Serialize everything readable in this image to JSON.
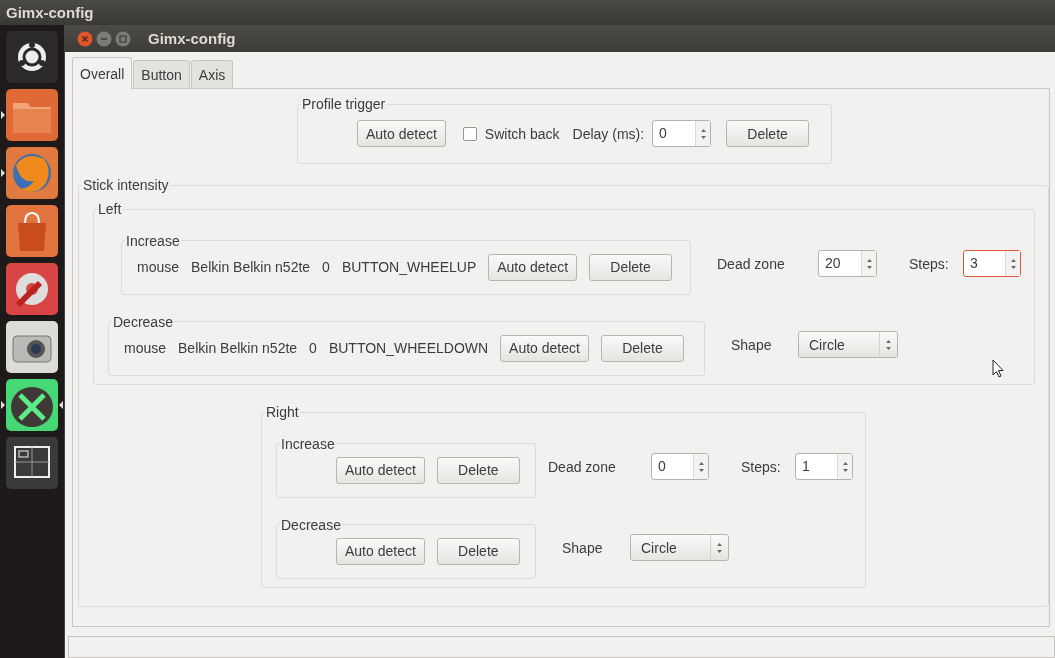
{
  "top_bar": {
    "title": "Gimx-config"
  },
  "launcher": {
    "items": [
      {
        "kind": "dash",
        "running": false,
        "selected": false
      },
      {
        "kind": "files",
        "running": true,
        "selected": false
      },
      {
        "kind": "browser",
        "running": true,
        "selected": false
      },
      {
        "kind": "store",
        "running": false,
        "selected": false
      },
      {
        "kind": "settings",
        "running": false,
        "selected": false
      },
      {
        "kind": "camera",
        "running": false,
        "selected": false
      },
      {
        "kind": "tools",
        "running": true,
        "selected": true
      },
      {
        "kind": "workspaces",
        "running": false,
        "selected": false
      }
    ]
  },
  "window": {
    "title": "Gimx-config"
  },
  "tabs": [
    {
      "label": "Overall",
      "selected": true
    },
    {
      "label": "Button",
      "selected": false
    },
    {
      "label": "Axis",
      "selected": false
    }
  ],
  "profile_trigger": {
    "title": "Profile trigger",
    "auto_detect": "Auto detect",
    "switch_back": {
      "label": "Switch back",
      "checked": false
    },
    "delay": {
      "label": "Delay (ms):",
      "value": "0",
      "focused": false
    },
    "delete": "Delete"
  },
  "stick_intensity": {
    "title": "Stick intensity",
    "sides": [
      {
        "title": "Left",
        "increase": {
          "title": "Increase",
          "device_type": "mouse",
          "device_name": "Belkin Belkin n52te",
          "device_id": "0",
          "event": "BUTTON_WHEELUP",
          "auto_detect": "Auto detect",
          "delete": "Delete"
        },
        "decrease": {
          "title": "Decrease",
          "device_type": "mouse",
          "device_name": "Belkin Belkin n52te",
          "device_id": "0",
          "event": "BUTTON_WHEELDOWN",
          "auto_detect": "Auto detect",
          "delete": "Delete"
        },
        "dead_zone": {
          "label": "Dead zone",
          "value": "20",
          "focused": false
        },
        "steps": {
          "label": "Steps:",
          "value": "3",
          "focused": true
        },
        "shape": {
          "label": "Shape",
          "value": "Circle"
        }
      },
      {
        "title": "Right",
        "increase": {
          "title": "Increase",
          "auto_detect": "Auto detect",
          "delete": "Delete"
        },
        "decrease": {
          "title": "Decrease",
          "auto_detect": "Auto detect",
          "delete": "Delete"
        },
        "dead_zone": {
          "label": "Dead zone",
          "value": "0",
          "focused": false
        },
        "steps": {
          "label": "Steps:",
          "value": "1",
          "focused": false
        },
        "shape": {
          "label": "Shape",
          "value": "Circle"
        }
      }
    ]
  }
}
